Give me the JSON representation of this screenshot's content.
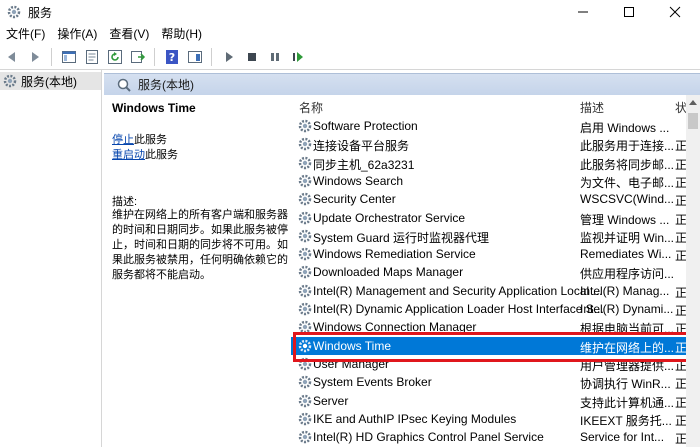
{
  "window": {
    "title": "服务"
  },
  "menu": [
    "文件(F)",
    "操作(A)",
    "查看(V)",
    "帮助(H)"
  ],
  "toolbar": {
    "buttons": [
      "back-icon",
      "forward-icon",
      "console-tree-icon",
      "properties-icon",
      "refresh-icon",
      "export-list-icon",
      "help-icon",
      "show-hide-icon",
      "start-icon",
      "stop-icon",
      "pause-icon",
      "restart-icon"
    ]
  },
  "tree": {
    "root_label": "服务(本地)"
  },
  "panel": {
    "header": "服务(本地)"
  },
  "description_pane": {
    "title": "Windows Time",
    "link_stop": "停止",
    "link_stop_suffix": "此服务",
    "link_restart": "重启动",
    "link_restart_suffix": "此服务",
    "desc_label": "描述:",
    "desc_text": "维护在网络上的所有客户端和服务器的时间和日期同步。如果此服务被停止，时间和日期的同步将不可用。如果此服务被禁用，任何明确依赖它的服务都将不能启动。"
  },
  "table": {
    "columns": {
      "name": "名称",
      "description": "描述",
      "status": "状"
    },
    "rows": [
      {
        "name": "Software Protection",
        "description": "启用 Windows ...",
        "status": ""
      },
      {
        "name": "连接设备平台服务",
        "description": "此服务用于连接...",
        "status": "正"
      },
      {
        "name": "同步主机_62a3231",
        "description": "此服务将同步邮...",
        "status": "正"
      },
      {
        "name": "Windows Search",
        "description": "为文件、电子邮...",
        "status": "正"
      },
      {
        "name": "Security Center",
        "description": "WSCSVC(Wind...",
        "status": "正"
      },
      {
        "name": "Update Orchestrator Service",
        "description": "管理 Windows ...",
        "status": "正"
      },
      {
        "name": "System Guard 运行时监视器代理",
        "description": "监视并证明 Win...",
        "status": "正"
      },
      {
        "name": "Windows Remediation Service",
        "description": "Remediates Wi...",
        "status": "正"
      },
      {
        "name": "Downloaded Maps Manager",
        "description": "供应用程序访问...",
        "status": ""
      },
      {
        "name": "Intel(R) Management and Security Application Local ...",
        "description": "Intel(R) Manag...",
        "status": "正"
      },
      {
        "name": "Intel(R) Dynamic Application Loader Host Interface S...",
        "description": "Intel(R) Dynami...",
        "status": "正"
      },
      {
        "name": "Windows Connection Manager",
        "description": "根据电脑当前可...",
        "status": "正"
      },
      {
        "name": "Windows Time",
        "description": "维护在网络上的...",
        "status": "正",
        "selected": true
      },
      {
        "name": "User Manager",
        "description": "用户管理器提供...",
        "status": "正"
      },
      {
        "name": "System Events Broker",
        "description": "协调执行 WinR...",
        "status": "正"
      },
      {
        "name": "Server",
        "description": "支持此计算机通...",
        "status": "正"
      },
      {
        "name": "IKE and AuthIP IPsec Keying Modules",
        "description": "IKEEXT 服务托...",
        "status": "正"
      },
      {
        "name": "Intel(R) HD Graphics Control Panel Service",
        "description": "Service for Int...",
        "status": "正"
      }
    ]
  },
  "colors": {
    "selection": "#0078d7",
    "highlight_box": "#e0161c",
    "link": "#0645ad"
  }
}
